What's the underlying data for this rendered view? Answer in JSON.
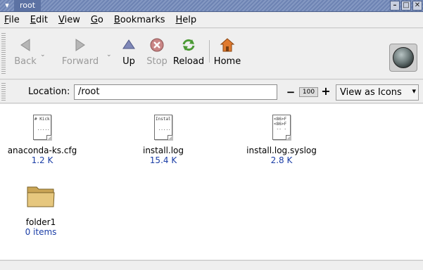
{
  "window": {
    "title": "root"
  },
  "menubar": {
    "items": [
      {
        "accel": "F",
        "rest": "ile"
      },
      {
        "accel": "E",
        "rest": "dit"
      },
      {
        "accel": "V",
        "rest": "iew"
      },
      {
        "accel": "G",
        "rest": "o"
      },
      {
        "accel": "B",
        "rest": "ookmarks"
      },
      {
        "accel": "H",
        "rest": "elp"
      }
    ]
  },
  "toolbar": {
    "back_label": "Back",
    "forward_label": "Forward",
    "up_label": "Up",
    "stop_label": "Stop",
    "reload_label": "Reload",
    "home_label": "Home"
  },
  "location": {
    "label": "Location:",
    "value": "/root",
    "zoom_out": "−",
    "zoom_level": "100",
    "zoom_in": "+",
    "view_as": "View as Icons"
  },
  "files": [
    {
      "name": "anaconda-ks.cfg",
      "size": "1.2 K",
      "preview": "# Kick\n\n ......."
    },
    {
      "name": "install.log",
      "size": "15.4 K",
      "preview": "Install\n\n ......."
    },
    {
      "name": "install.log.syslog",
      "size": "2.8 K",
      "preview": "<86>F\n<86>F\n -- -"
    },
    {
      "name": "folder1",
      "size": "0 items"
    }
  ],
  "colors": {
    "titlebar": "#6d83b3",
    "size_text": "#1a3da6",
    "folder": "#d9b96a"
  }
}
